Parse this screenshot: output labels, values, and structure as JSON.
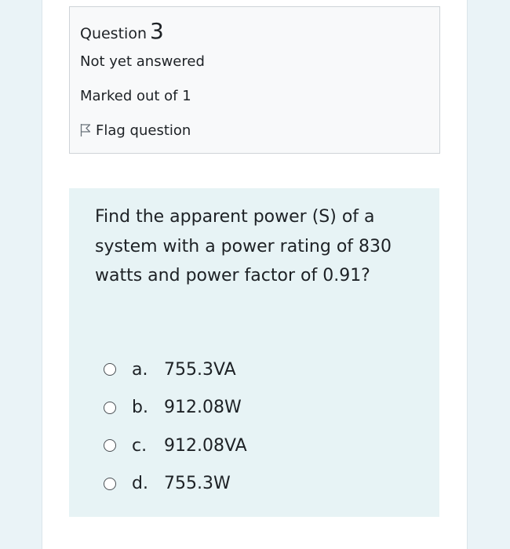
{
  "info": {
    "question_label": "Question",
    "question_number": "3",
    "state": "Not yet answered",
    "grade": "Marked out of 1",
    "flag_label": "Flag question"
  },
  "question": {
    "text": "Find the apparent power (S) of a system with a power rating of 830 watts and power factor of 0.91?",
    "options": [
      {
        "letter": "a.",
        "text": "755.3VA"
      },
      {
        "letter": "b.",
        "text": "912.08W"
      },
      {
        "letter": "c.",
        "text": "912.08VA"
      },
      {
        "letter": "d.",
        "text": "755.3W"
      }
    ]
  }
}
